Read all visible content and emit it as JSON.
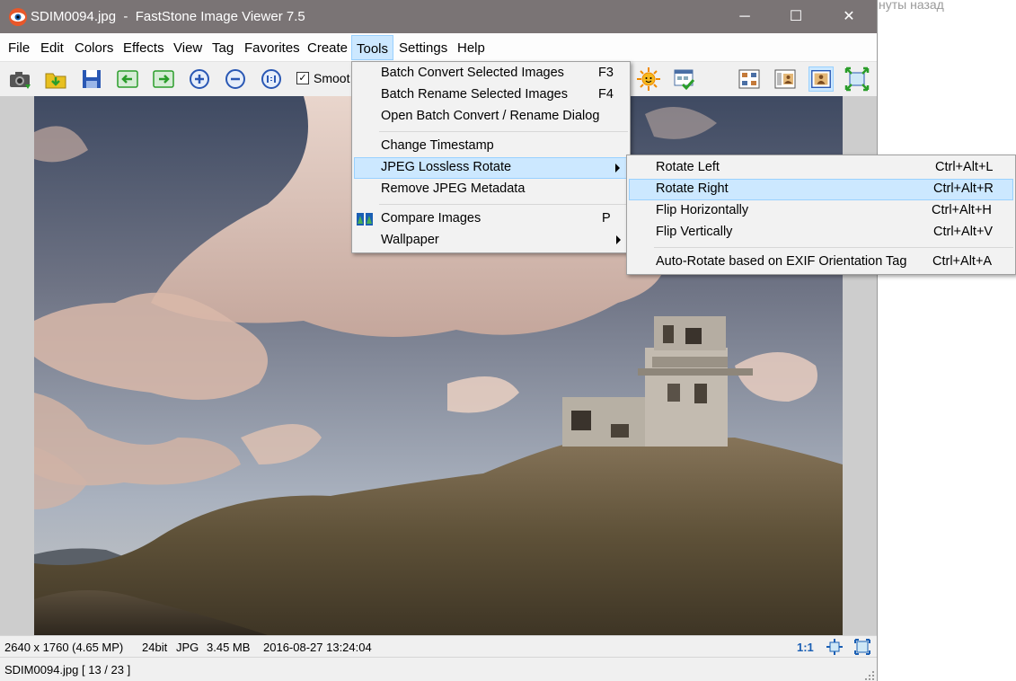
{
  "background": {
    "partial_text": "нуты назад"
  },
  "window": {
    "title": "SDIM0094.jpg  -  FastStone Image Viewer 7.5",
    "controls": {
      "minimize": "─",
      "maximize": "☐",
      "close": "✕"
    }
  },
  "menubar": {
    "items": [
      "File",
      "Edit",
      "Colors",
      "Effects",
      "View",
      "Tag",
      "Favorites",
      "Create",
      "Tools",
      "Settings",
      "Help"
    ],
    "active": "Tools"
  },
  "toolbar": {
    "buttons": [
      "camera-icon",
      "open-folder-icon",
      "save-icon",
      "previous-icon",
      "next-icon",
      "zoom-in-icon",
      "zoom-out-icon",
      "actual-size-icon",
      "sun-effects-icon",
      "slideshow-check-icon",
      "thumbnails-icon",
      "browser-icon",
      "fullscreen-person-icon",
      "fit-screen-icon"
    ],
    "smooth": {
      "label": "Smoot",
      "checked": true
    }
  },
  "tools_menu": {
    "items": [
      {
        "label": "Batch Convert Selected Images",
        "shortcut": "F3"
      },
      {
        "label": "Batch Rename Selected Images",
        "shortcut": "F4"
      },
      {
        "label": "Open Batch Convert / Rename Dialog",
        "shortcut": ""
      },
      {
        "label": "Change Timestamp",
        "shortcut": ""
      },
      {
        "label": "JPEG Lossless Rotate",
        "shortcut": "",
        "submenu": true,
        "highlighted": true
      },
      {
        "label": "Remove JPEG Metadata",
        "shortcut": ""
      },
      {
        "label": "Compare Images",
        "shortcut": "P",
        "icon": "compare-icon"
      },
      {
        "label": "Wallpaper",
        "shortcut": "",
        "submenu": true
      }
    ]
  },
  "rotate_submenu": {
    "items": [
      {
        "label": "Rotate Left",
        "shortcut": "Ctrl+Alt+L"
      },
      {
        "label": "Rotate Right",
        "shortcut": "Ctrl+Alt+R",
        "highlighted": true
      },
      {
        "label": "Flip Horizontally",
        "shortcut": "Ctrl+Alt+H"
      },
      {
        "label": "Flip Vertically",
        "shortcut": "Ctrl+Alt+V"
      },
      {
        "label": "Auto-Rotate based on EXIF Orientation Tag",
        "shortcut": "Ctrl+Alt+A"
      }
    ]
  },
  "statusbar": {
    "dimensions": "2640 x 1760 (4.65 MP)",
    "bitdepth": "24bit",
    "format": "JPG",
    "filesize": "3.45 MB",
    "datetime": "2016-08-27 13:24:04",
    "zoom": "1:1",
    "file_position": "SDIM0094.jpg [ 13 / 23 ]"
  },
  "colors": {
    "titlebar": "#7a7475",
    "menu_highlight": "#cce8ff",
    "menu_highlight_border": "#99d1ff",
    "zoom_text": "#1a5fb4"
  }
}
